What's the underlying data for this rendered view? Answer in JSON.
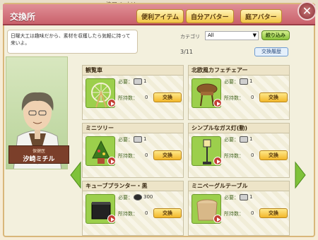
{
  "background": {
    "strip_text": "湊口 シオリ"
  },
  "window": {
    "title": "交換所",
    "buttons": [
      {
        "label": "便利アイテム"
      },
      {
        "label": "自分アバター"
      },
      {
        "label": "庭アバター"
      }
    ]
  },
  "npc": {
    "speech": "日曜大工は趣味だから、素材を収穫したら気軽に持って来いよ。",
    "role": "保健医",
    "name": "汐崎ミチル"
  },
  "filter": {
    "label": "カテゴリ",
    "value": "All",
    "button_label": "絞り込み"
  },
  "history_button": "交換履歴",
  "page": "3/11",
  "items": [
    {
      "name": "観覧車",
      "required_label": "必要：",
      "required_count": "1",
      "owned_label": "所持数：",
      "owned": "0",
      "exchange_label": "交換"
    },
    {
      "name": "北欧風カフェチェアー",
      "required_label": "必要：",
      "required_count": "1",
      "owned_label": "所持数：",
      "owned": "0",
      "exchange_label": "交換"
    },
    {
      "name": "ミニツリー",
      "required_label": "必要：",
      "required_count": "1",
      "owned_label": "所持数：",
      "owned": "0",
      "exchange_label": "交換"
    },
    {
      "name": "シンプルなガス灯(動)",
      "required_label": "必要：",
      "required_count": "1",
      "owned_label": "所持数：",
      "owned": "0",
      "exchange_label": "交換"
    },
    {
      "name": "キューブプランター・黒",
      "required_label": "必要：",
      "required_count": "300",
      "owned_label": "所持数：",
      "owned": "0",
      "exchange_label": "交換"
    },
    {
      "name": "ミニベーグルテーブル",
      "required_label": "必要：",
      "required_count": "1",
      "owned_label": "所持数：",
      "owned": "0",
      "exchange_label": "交換"
    }
  ],
  "colors": {
    "title_bar": "#c9616b",
    "accent_green": "#8ac23a",
    "exchange_button": "#f2b72a"
  }
}
